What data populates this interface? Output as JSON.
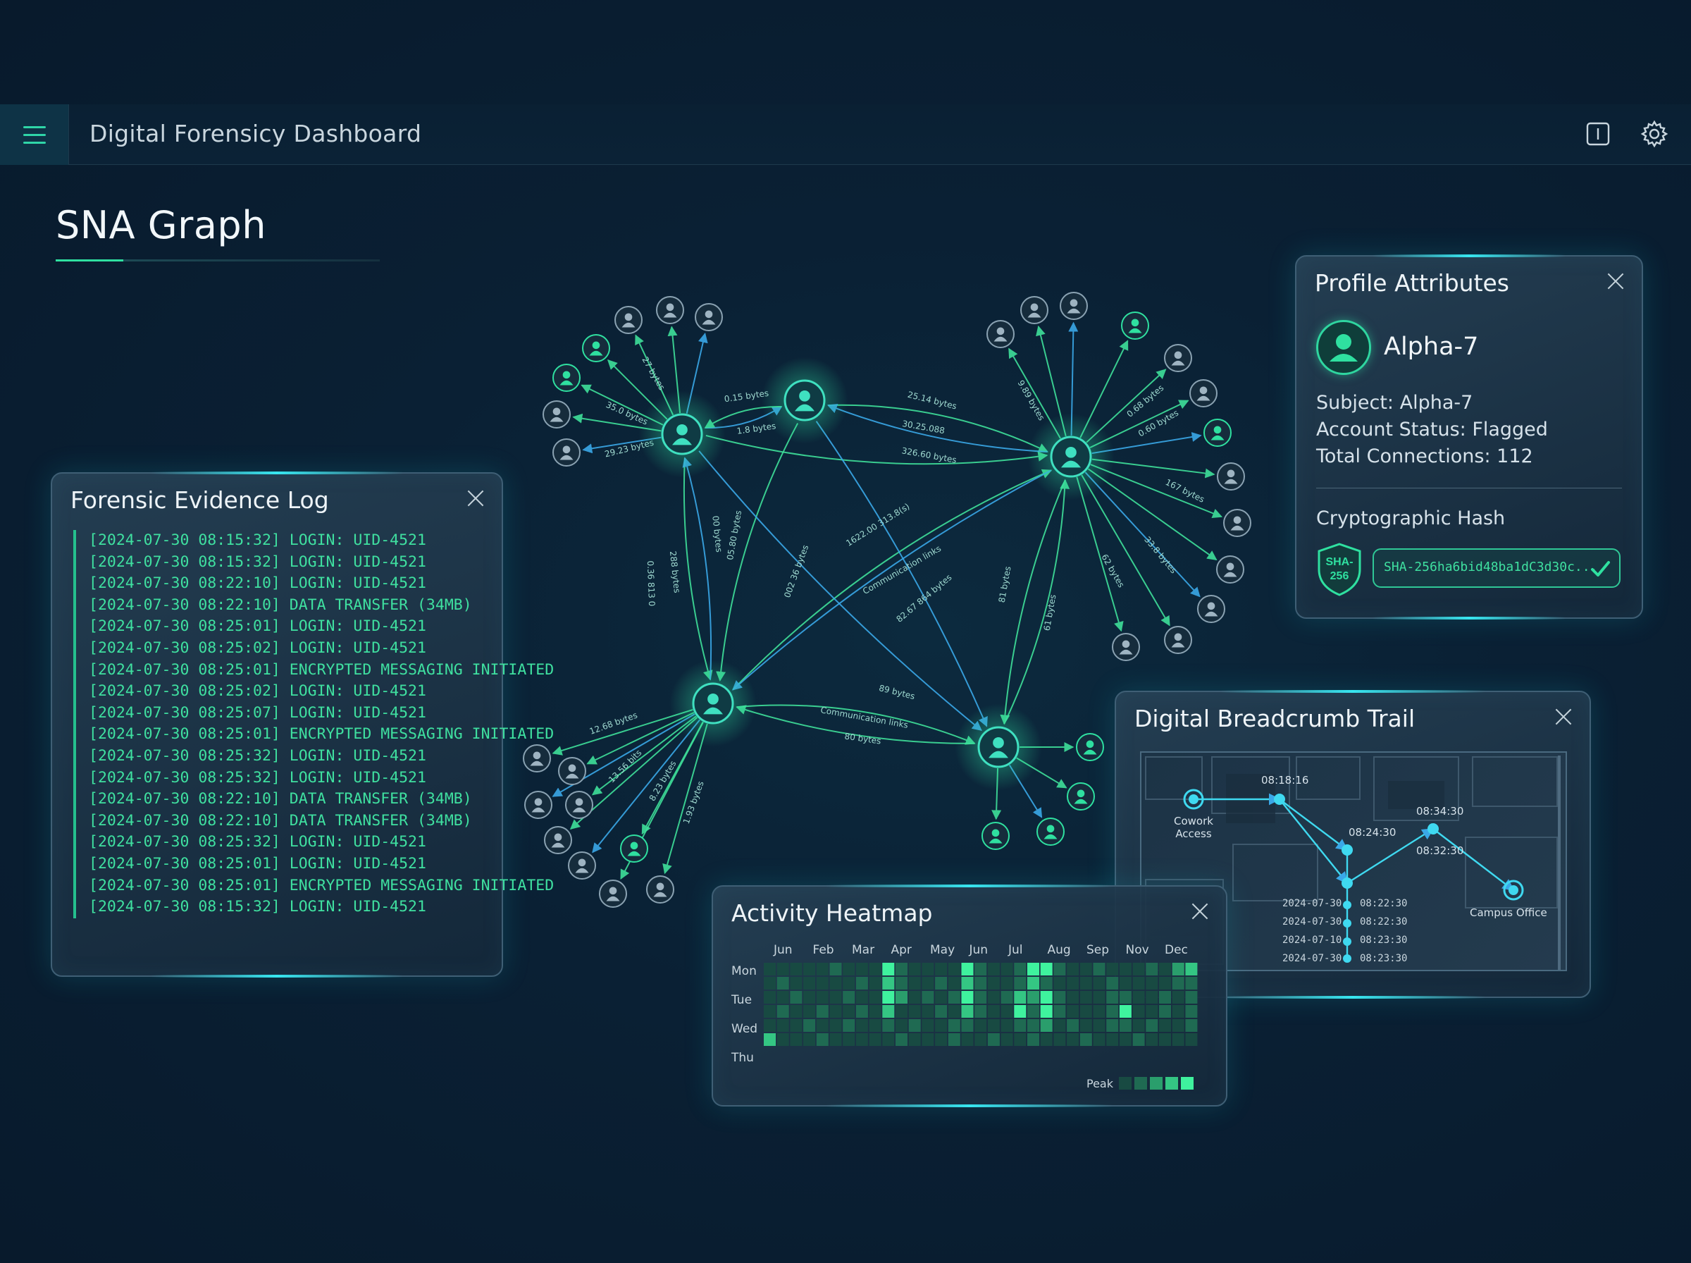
{
  "header": {
    "app_title": "Digital Forensicy Dashboard",
    "menu_icon": "menu-icon",
    "info_icon": "info-icon",
    "settings_icon": "gear-icon"
  },
  "page": {
    "title": "SNA Graph"
  },
  "colors": {
    "accent": "#2fe0a0",
    "edge_blue": "#3aa8e8",
    "background": "#0a2034"
  },
  "graph": {
    "edge_labels": [
      "0.15 bytes",
      "1.8 bytes",
      "27 bytes",
      "35.0 bytes",
      "29.23 bytes",
      "25.14 bytes",
      "30.25.088",
      "326.60 bytes",
      "9.89 bytes",
      "0.68 bytes",
      "0.60 bytes",
      "167 bytes",
      "33.8 bytes",
      "62 bytes",
      "00 bytes",
      "05.80 bytes",
      "288 bytes",
      "0.36 813 0",
      "002 36 bytes",
      "1622.00 313.8(s)",
      "Communication links",
      "82.67 864 bytes",
      "81 bytes",
      "61 bytes",
      "89 bytes",
      "Communication links",
      "80 bytes",
      "12.68 bytes",
      "13.56 bits",
      "8.23 bytes",
      "1.93 bytes"
    ]
  },
  "evidence_log": {
    "title": "Forensic Evidence Log",
    "entries": [
      "[2024-07-30 08:15:32] LOGIN: UID-4521",
      "[2024-07-30 08:15:32] LOGIN: UID-4521",
      "[2024-07-30 08:22:10] LOGIN: UID-4521",
      "[2024-07-30 08:22:10] DATA TRANSFER (34MB)",
      "[2024-07-30 08:25:01] LOGIN: UID-4521",
      "[2024-07-30 08:25:02] LOGIN: UID-4521",
      "[2024-07-30 08:25:01] ENCRYPTED MESSAGING INITIATED",
      "[2024-07-30 08:25:02] LOGIN: UID-4521",
      "[2024-07-30 08:25:07] LOGIN: UID-4521",
      "[2024-07-30 08:25:01] ENCRYPTED MESSAGING INITIATED",
      "[2024-07-30 08:25:32] LOGIN: UID-4521",
      "[2024-07-30 08:25:32] LOGIN: UID-4521",
      "[2024-07-30 08:22:10] DATA TRANSFER (34MB)",
      "[2024-07-30 08:22:10] DATA TRANSFER (34MB)",
      "[2024-07-30 08:25:32] LOGIN: UID-4521",
      "[2024-07-30 08:25:01] LOGIN: UID-4521",
      "[2024-07-30 08:25:01] ENCRYPTED MESSAGING INITIATED",
      "[2024-07-30 08:15:32] LOGIN: UID-4521"
    ]
  },
  "profile": {
    "title": "Profile Attributes",
    "name": "Alpha-7",
    "subject": "Subject: Alpha-7",
    "account_status": "Account Status: Flagged",
    "total_connections": "Total Connections: 112",
    "hash_label": "Cryptographic Hash",
    "shield_line1": "SHA-",
    "shield_line2": "256",
    "hash_value": "SHA-256ha6bid48ba1dC3d30c...",
    "check_icon": "check-icon"
  },
  "breadcrumb": {
    "title": "Digital Breadcrumb Trail",
    "start_label_1": "Cowork",
    "start_label_2": "Access",
    "times": [
      "08:18:16",
      "08:24:30",
      "08:34:30",
      "08:32:30"
    ],
    "end_label": "Campus Office",
    "timeline": [
      {
        "date": "2024-07-30",
        "time": "08:22:30"
      },
      {
        "date": "2024-07-30",
        "time": "08:22:30"
      },
      {
        "date": "2024-07-10",
        "time": "08:23:30"
      },
      {
        "date": "2024-07-30",
        "time": "08:23:30"
      }
    ]
  },
  "heatmap": {
    "title": "Activity Heatmap",
    "months": [
      "Jun",
      "Feb",
      "Mar",
      "Apr",
      "May",
      "Jun",
      "Jul",
      "Aug",
      "Sep",
      "Nov",
      "Dec"
    ],
    "days": [
      "Mon",
      "Tue",
      "Wed",
      "Thu"
    ],
    "legend_label": "Peak",
    "intensity": [
      [
        1,
        1,
        1,
        1,
        1,
        2,
        1,
        1,
        1,
        5,
        2,
        1,
        1,
        1,
        1,
        5,
        2,
        1,
        1,
        2,
        5,
        5,
        2,
        1,
        1,
        2,
        1,
        1,
        1,
        2,
        1,
        3,
        4
      ],
      [
        1,
        2,
        1,
        1,
        1,
        1,
        1,
        2,
        1,
        4,
        2,
        1,
        1,
        2,
        1,
        4,
        2,
        1,
        1,
        2,
        4,
        2,
        1,
        1,
        1,
        1,
        2,
        1,
        1,
        1,
        1,
        2,
        2
      ],
      [
        1,
        1,
        2,
        1,
        1,
        1,
        2,
        1,
        1,
        5,
        3,
        1,
        2,
        1,
        2,
        5,
        2,
        1,
        2,
        4,
        3,
        5,
        2,
        1,
        1,
        1,
        2,
        2,
        1,
        1,
        2,
        1,
        2
      ],
      [
        1,
        2,
        1,
        1,
        2,
        1,
        1,
        2,
        1,
        4,
        1,
        1,
        1,
        2,
        1,
        4,
        2,
        1,
        1,
        5,
        2,
        5,
        2,
        1,
        1,
        1,
        2,
        5,
        1,
        1,
        2,
        1,
        2
      ],
      [
        1,
        1,
        1,
        2,
        1,
        1,
        2,
        1,
        1,
        2,
        1,
        2,
        1,
        1,
        2,
        2,
        1,
        1,
        1,
        2,
        2,
        3,
        1,
        2,
        1,
        1,
        2,
        2,
        1,
        2,
        1,
        1,
        2
      ],
      [
        4,
        1,
        1,
        1,
        2,
        1,
        1,
        1,
        1,
        1,
        2,
        1,
        1,
        1,
        2,
        1,
        1,
        2,
        1,
        1,
        2,
        1,
        1,
        1,
        2,
        1,
        1,
        1,
        2,
        1,
        1,
        1,
        1
      ]
    ]
  }
}
